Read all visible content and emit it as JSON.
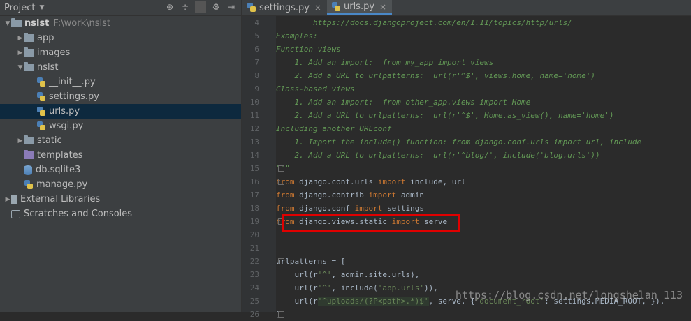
{
  "project_panel": {
    "title": "Project",
    "tree": [
      {
        "label": "nslst",
        "path": "F:\\work\\nslst",
        "type": "project",
        "indent": 0,
        "expanded": true
      },
      {
        "label": "app",
        "type": "folder",
        "indent": 1,
        "expanded": false
      },
      {
        "label": "images",
        "type": "folder",
        "indent": 1,
        "expanded": false
      },
      {
        "label": "nslst",
        "type": "folder",
        "indent": 1,
        "expanded": true
      },
      {
        "label": "__init__.py",
        "type": "py",
        "indent": 2
      },
      {
        "label": "settings.py",
        "type": "py",
        "indent": 2
      },
      {
        "label": "urls.py",
        "type": "py",
        "indent": 2,
        "selected": true
      },
      {
        "label": "wsgi.py",
        "type": "py",
        "indent": 2
      },
      {
        "label": "static",
        "type": "folder",
        "indent": 1,
        "expanded": false
      },
      {
        "label": "templates",
        "type": "templates",
        "indent": 1
      },
      {
        "label": "db.sqlite3",
        "type": "db",
        "indent": 1
      },
      {
        "label": "manage.py",
        "type": "py",
        "indent": 1
      },
      {
        "label": "External Libraries",
        "type": "lib",
        "indent": 0,
        "expanded": false
      },
      {
        "label": "Scratches and Consoles",
        "type": "scratch",
        "indent": 0
      }
    ]
  },
  "tabs": [
    {
      "label": "settings.py",
      "active": false
    },
    {
      "label": "urls.py",
      "active": true
    }
  ],
  "code": {
    "lines": [
      {
        "n": "4",
        "html": "<span class='doc'>        https://docs.djangoproject.com/en/1.11/topics/http/urls/</span>"
      },
      {
        "n": "5",
        "html": "<span class='doc'>Examples:</span>"
      },
      {
        "n": "6",
        "html": "<span class='doc'>Function views</span>"
      },
      {
        "n": "7",
        "html": "<span class='doc'>    1. Add an import:  from my_app import views</span>"
      },
      {
        "n": "8",
        "html": "<span class='doc'>    2. Add a URL to urlpatterns:  url(r'^$', views.home, name='home')</span>"
      },
      {
        "n": "9",
        "html": "<span class='doc'>Class-based views</span>"
      },
      {
        "n": "10",
        "html": "<span class='doc'>    1. Add an import:  from other_app.views import Home</span>"
      },
      {
        "n": "11",
        "html": "<span class='doc'>    2. Add a URL to urlpatterns:  url(r'^$', Home.as_view(), name='home')</span>"
      },
      {
        "n": "12",
        "html": "<span class='doc'>Including another URLconf</span>"
      },
      {
        "n": "13",
        "html": "<span class='doc'>    1. Import the include() function: from django.conf.urls import url, include</span>"
      },
      {
        "n": "14",
        "html": "<span class='doc'>    2. Add a URL to urlpatterns:  url(r'^blog/', include('blog.urls'))</span>"
      },
      {
        "n": "15",
        "html": "<span class='doc'>\"\"\"</span>"
      },
      {
        "n": "16",
        "html": "<span class='kw'>from</span> django.conf.urls <span class='kw'>import</span> include, url"
      },
      {
        "n": "17",
        "html": "<span class='kw'>from</span> django.contrib <span class='kw'>import</span> admin"
      },
      {
        "n": "18",
        "html": "<span class='kw'>from</span> django.conf <span class='kw'>import</span> settings"
      },
      {
        "n": "19",
        "html": "<span class='kw'>from</span> django.views.static <span class='kw'>import</span> serve"
      },
      {
        "n": "20",
        "html": ""
      },
      {
        "n": "21",
        "html": ""
      },
      {
        "n": "22",
        "html": "urlpatterns = ["
      },
      {
        "n": "23",
        "html": "    url(r<span class='str'>'^'</span>, admin.site.urls),"
      },
      {
        "n": "24",
        "html": "    url(r<span class='str'>'^'</span>, include(<span class='str'>'app.urls'</span>)),"
      },
      {
        "n": "25",
        "html": "    url(r<span class='rx'>'^uploads/(?P&lt;path&gt;.*)$'</span>, serve, {<span class='str'>'document_root'</span>: settings.MEDIA_ROOT, }),"
      },
      {
        "n": "26",
        "html": "]"
      }
    ]
  },
  "watermark": "https://blog.csdn.net/longshelan_113",
  "colors": {
    "highlight": "#e00000",
    "selection": "#0d293e",
    "tab_accent": "#4a88c7"
  }
}
